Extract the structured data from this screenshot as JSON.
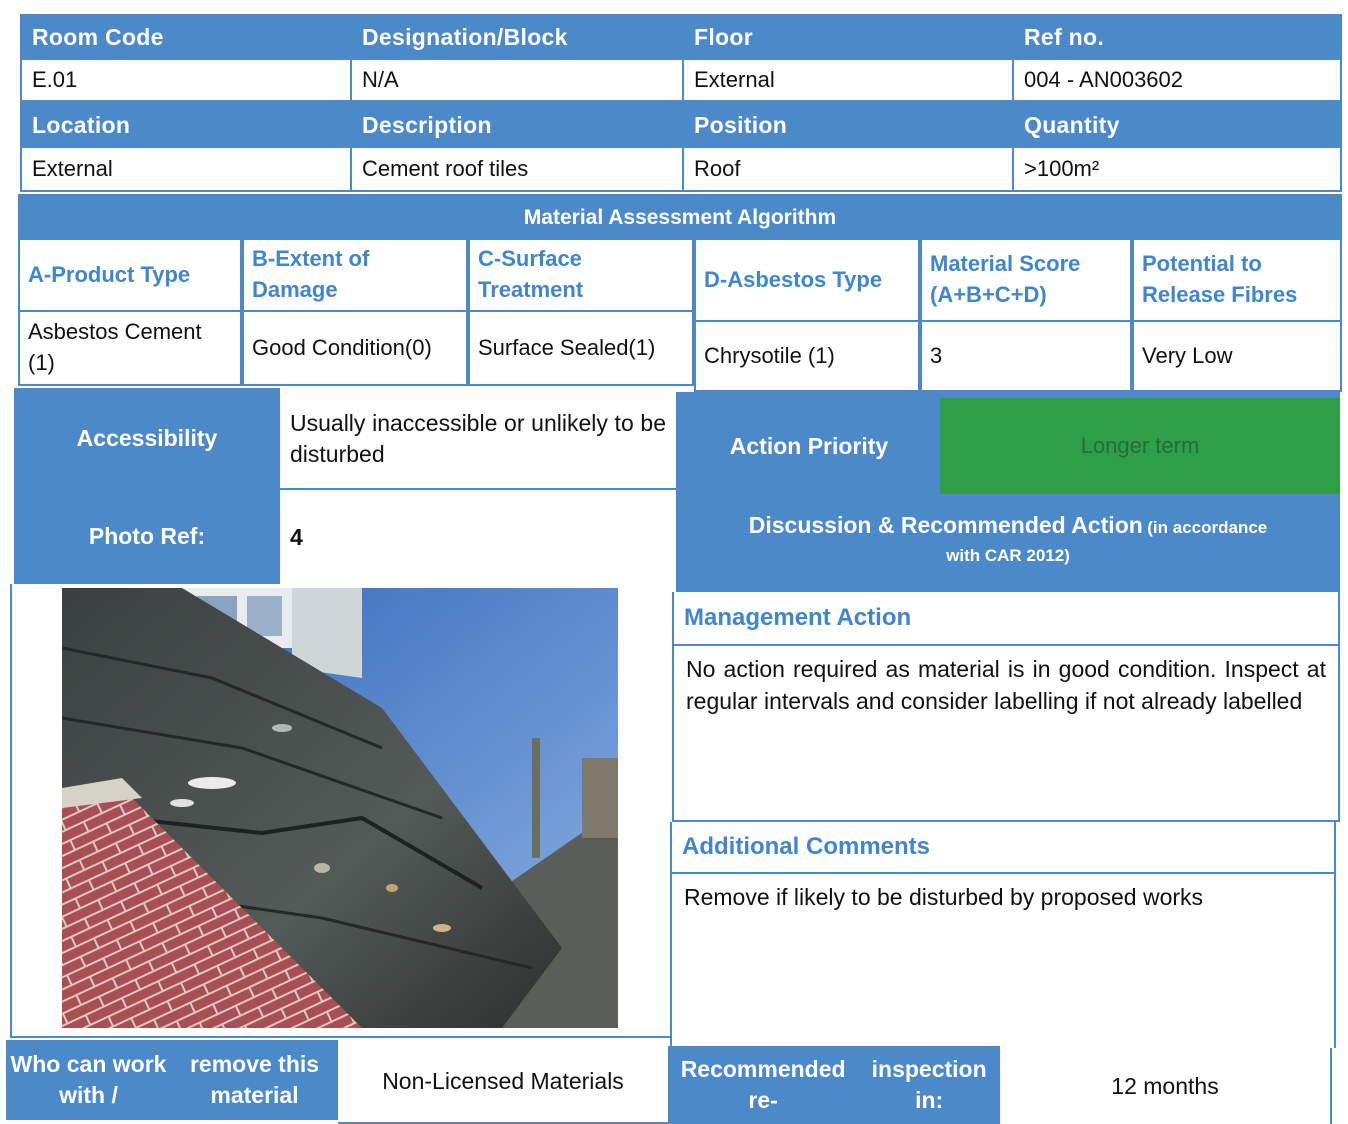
{
  "row1": {
    "headers": [
      "Room Code",
      "Designation/Block",
      "Floor",
      "Ref no."
    ],
    "values": [
      "E.01",
      "N/A",
      "External",
      "004 - AN003602"
    ]
  },
  "row2": {
    "headers": [
      "Location",
      "Description",
      "Position",
      "Quantity"
    ],
    "values": [
      "External",
      "Cement roof tiles",
      "Roof",
      ">100m²"
    ]
  },
  "algorithm": {
    "title": "Material Assessment Algorithm",
    "headers": [
      "A-Product Type",
      "B-Extent of Damage",
      "C-Surface Treatment",
      "D-Asbestos Type",
      "Material Score (A+B+C+D)",
      "Potential to Release Fibres"
    ],
    "values": [
      "Asbestos Cement (1)",
      "Good Condition(0)",
      "Surface Sealed(1)",
      "Chrysotile (1)",
      "3",
      "Very Low"
    ]
  },
  "accessibility": {
    "label": "Accessibility",
    "value": "Usually inaccessible or unlikely to be disturbed"
  },
  "photo_ref": {
    "label": "Photo Ref:",
    "value": "4"
  },
  "action_priority": {
    "label": "Action Priority",
    "value": "Longer term",
    "color": "#2e9e48"
  },
  "discussion": {
    "label": "Discussion & Recommended Action",
    "suffix_line1": "(in accordance",
    "suffix_line2": "with CAR 2012)"
  },
  "management": {
    "title": "Management Action",
    "text": "No action required as material is in good condition. Inspect at regular intervals and consider labelling if not already labelled"
  },
  "additional": {
    "title": "Additional Comments",
    "text": "Remove if likely to be disturbed by proposed works"
  },
  "footer": {
    "who_label_1": "Who can work with /",
    "who_label_2": "remove this material",
    "who_value": "Non-Licensed Materials",
    "reinspect_label_1": "Recommended re-",
    "reinspect_label_2": "inspection in:",
    "reinspect_value": "12 months"
  },
  "colors": {
    "header_blue": "#4b89c9",
    "label_text_blue": "#3f86cf",
    "priority_green": "#2e9e48"
  }
}
